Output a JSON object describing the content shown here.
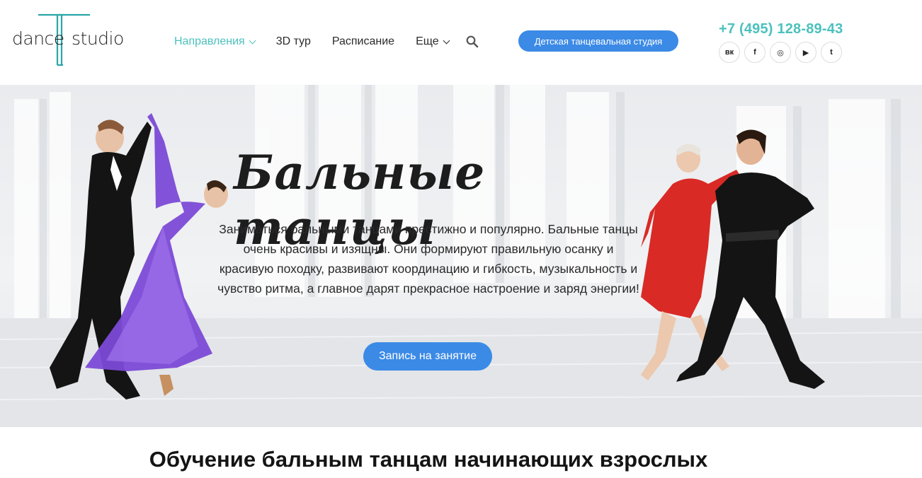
{
  "logo": {
    "word1": "dance",
    "word2": "studio"
  },
  "nav": {
    "items": [
      {
        "label": "Направления",
        "active": true,
        "dropdown": true
      },
      {
        "label": "3D тур",
        "active": false,
        "dropdown": false
      },
      {
        "label": "Расписание",
        "active": false,
        "dropdown": false
      },
      {
        "label": "Еще",
        "active": false,
        "dropdown": true
      }
    ],
    "search_icon": "search-icon"
  },
  "header": {
    "kids_button": "Детская танцевальная студия",
    "phone": "+7 (495) 128-89-43",
    "socials": [
      "vk-icon",
      "facebook-icon",
      "instagram-icon",
      "youtube-icon",
      "twitter-icon"
    ],
    "social_glyphs": [
      "вк",
      "f",
      "◎",
      "▶",
      "t"
    ]
  },
  "hero": {
    "title": "Бальные танцы",
    "text": "Заниматься бальными танцами престижно и популярно. Бальные танцы очень красивы и изящны. Они формируют правильную осанку и красивую походку, развивают координацию и гибкость, музыкальность и чувство ритма, а главное дарят прекрасное настроение и заряд энергии!",
    "button": "Запись на занятие"
  },
  "section": {
    "title": "Обучение бальным танцам начинающих взрослых"
  },
  "colors": {
    "accent": "#4cc1bd",
    "button": "#3b8ae6",
    "text": "#2b2b2b"
  }
}
